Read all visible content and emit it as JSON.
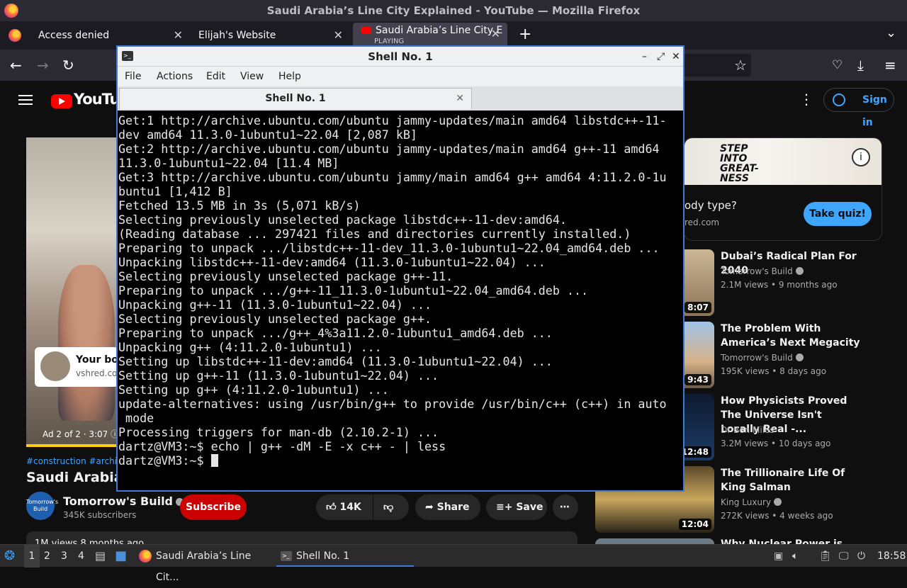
{
  "window_title": "Saudi Arabia’s Line City Explained - YouTube — Mozilla Firefox",
  "browser": {
    "tabs": [
      {
        "label": "Access denied"
      },
      {
        "label": "Elijah's Website"
      },
      {
        "label": "Saudi Arabia’s Line City E",
        "status": "PLAYING"
      }
    ],
    "new_tab": "+",
    "tab_list": "⌄"
  },
  "youtube": {
    "logo": "YouTube",
    "sign_in": "Sign in",
    "player": {
      "ad_card_title": "Your bod",
      "ad_card_domain": "vshred.co",
      "ad_info": "Ad 2 of 2 · 3:07 ⓘ"
    },
    "tags": "#construction #architect",
    "video_title": "Saudi Arabia’s L",
    "channel": {
      "avatar_text": "Tomorrow's Build",
      "name": "Tomorrow's Build",
      "subscribers": "345K subscribers",
      "subscribe": "Subscribe"
    },
    "actions": {
      "likes": "14K",
      "share": "Share",
      "save": "Save",
      "more": "⋯"
    },
    "description_peek": "1M views  8 months ago",
    "side_ad": {
      "banner_text": "STEP INTO GREAT-NESS",
      "question": "ody type?",
      "domain": "red.com",
      "cta": "Take quiz!"
    },
    "recommendations": [
      {
        "title": "Dubai’s Radical Plan For 2040",
        "channel": "Tomorrow's Build",
        "meta": "2.1M views • 9 months ago",
        "duration": "8:07"
      },
      {
        "title": "The Problem With America’s Next Megacity",
        "channel": "Tomorrow's Build",
        "meta": "195K views • 8 days ago",
        "duration": "9:43"
      },
      {
        "title": "How Physicists Proved The Universe Isn't Locally Real -...",
        "channel": "Dr Ben Miles",
        "meta": "3.2M views • 10 days ago",
        "duration": "12:48"
      },
      {
        "title": "The Trillionaire Life Of King Salman",
        "channel": "King Luxury",
        "meta": "272K views • 4 weeks ago",
        "duration": "12:04"
      },
      {
        "title": "Why Nuclear Power is Making a",
        "channel": "",
        "meta": "",
        "duration": ""
      }
    ]
  },
  "terminal": {
    "title": "Shell No. 1",
    "menu": [
      "File",
      "Actions",
      "Edit",
      "View",
      "Help"
    ],
    "tab_label": "Shell No. 1",
    "lines": [
      "Get:1 http://archive.ubuntu.com/ubuntu jammy-updates/main amd64 libstdc++-11-",
      "dev amd64 11.3.0-1ubuntu1~22.04 [2,087 kB]",
      "Get:2 http://archive.ubuntu.com/ubuntu jammy-updates/main amd64 g++-11 amd64",
      "11.3.0-1ubuntu1~22.04 [11.4 MB]",
      "Get:3 http://archive.ubuntu.com/ubuntu jammy/main amd64 g++ amd64 4:11.2.0-1u",
      "buntu1 [1,412 B]",
      "Fetched 13.5 MB in 3s (5,071 kB/s)",
      "Selecting previously unselected package libstdc++-11-dev:amd64.",
      "(Reading database ... 297421 files and directories currently installed.)",
      "Preparing to unpack .../libstdc++-11-dev_11.3.0-1ubuntu1~22.04_amd64.deb ...",
      "Unpacking libstdc++-11-dev:amd64 (11.3.0-1ubuntu1~22.04) ...",
      "Selecting previously unselected package g++-11.",
      "Preparing to unpack .../g++-11_11.3.0-1ubuntu1~22.04_amd64.deb ...",
      "Unpacking g++-11 (11.3.0-1ubuntu1~22.04) ...",
      "Selecting previously unselected package g++.",
      "Preparing to unpack .../g++_4%3a11.2.0-1ubuntu1_amd64.deb ...",
      "Unpacking g++ (4:11.2.0-1ubuntu1) ...",
      "Setting up libstdc++-11-dev:amd64 (11.3.0-1ubuntu1~22.04) ...",
      "Setting up g++-11 (11.3.0-1ubuntu1~22.04) ...",
      "Setting up g++ (4:11.2.0-1ubuntu1) ...",
      "update-alternatives: using /usr/bin/g++ to provide /usr/bin/c++ (c++) in auto",
      " mode",
      "Processing triggers for man-db (2.10.2-1) ...",
      "dartz@VM3:~$ echo | g++ -dM -E -x c++ - | less",
      "dartz@VM3:~$ "
    ]
  },
  "taskbar": {
    "workspaces": [
      "1",
      "2",
      "3",
      "4"
    ],
    "tasks": [
      {
        "label": "Saudi Arabia’s Line Cit..."
      },
      {
        "label": "Shell No. 1"
      }
    ],
    "clock": "18:58"
  }
}
